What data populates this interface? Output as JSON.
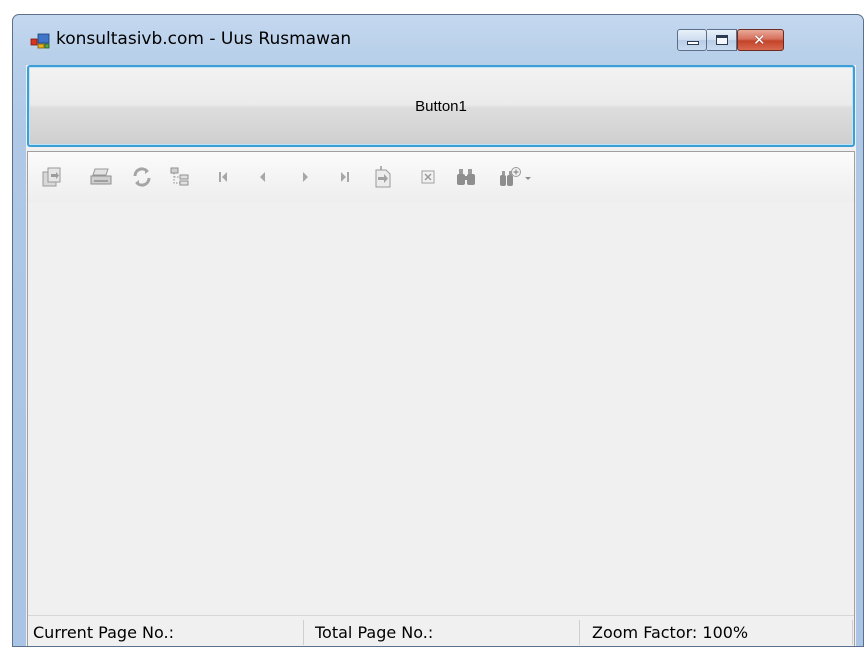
{
  "window": {
    "title": "konsultasivb.com - Uus Rusmawan",
    "close_glyph": "✕"
  },
  "main": {
    "button_label": "Button1"
  },
  "toolbar": {
    "icons": [
      "export-report-icon",
      "print-icon",
      "refresh-icon",
      "toggle-group-tree-icon",
      "first-page-icon",
      "previous-page-icon",
      "next-page-icon",
      "last-page-icon",
      "go-to-page-icon",
      "close-current-view-icon",
      "find-text-icon",
      "zoom-icon"
    ]
  },
  "statusbar": {
    "current_page": "Current Page No.:",
    "total_page": "Total Page No.:",
    "zoom_factor": "Zoom Factor: 100%"
  },
  "colors": {
    "focus_border": "#3c9fd5",
    "title_bar": "#b9d0ea",
    "close_button": "#c4432a"
  }
}
